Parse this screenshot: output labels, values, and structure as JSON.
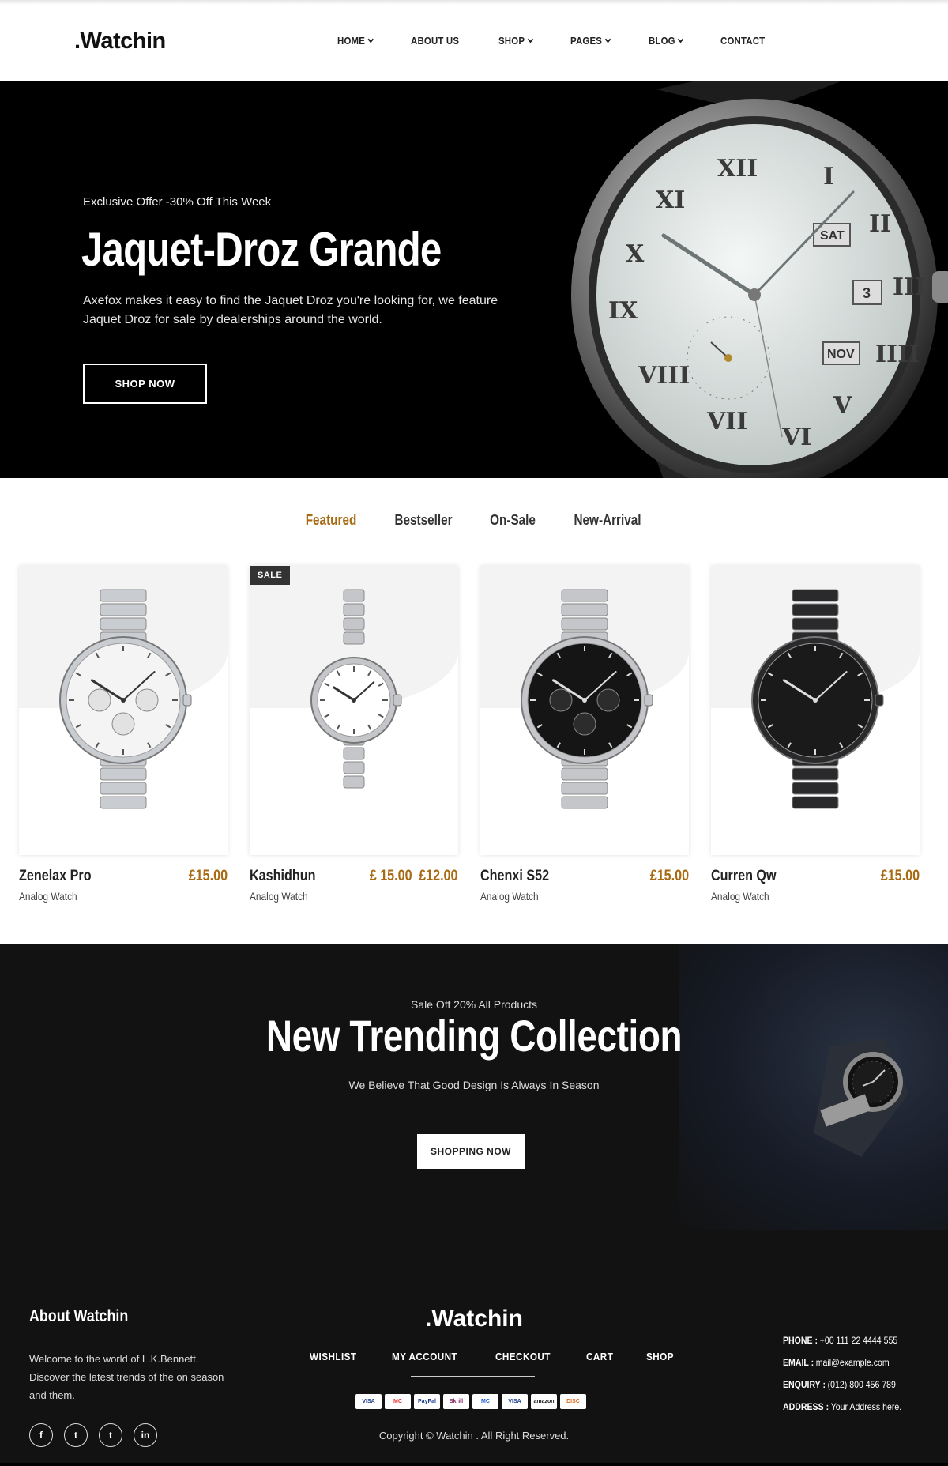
{
  "header": {
    "logo": ".Watchin",
    "nav": [
      {
        "label": "HOME",
        "dropdown": true
      },
      {
        "label": "ABOUT US",
        "dropdown": false
      },
      {
        "label": "SHOP",
        "dropdown": true
      },
      {
        "label": "PAGES",
        "dropdown": true
      },
      {
        "label": "BLOG",
        "dropdown": true
      },
      {
        "label": "CONTACT",
        "dropdown": false
      }
    ]
  },
  "hero": {
    "offer": "Exclusive Offer -30% Off This Week",
    "title": "Jaquet-Droz Grande",
    "description": "Axefox makes it easy to find the Jaquet Droz you're looking for, we feature Jaquet Droz for sale by dealerships around the world.",
    "button": "SHOP NOW",
    "watch_labels": {
      "day": "SAT",
      "date": "3",
      "month": "NOV"
    }
  },
  "tabs": [
    {
      "label": "Featured",
      "active": true
    },
    {
      "label": "Bestseller",
      "active": false
    },
    {
      "label": "On-Sale",
      "active": false
    },
    {
      "label": "New-Arrival",
      "active": false
    }
  ],
  "products": [
    {
      "name": "Zenelax Pro",
      "category": "Analog Watch",
      "price": "£15.00",
      "old_price": "",
      "sale": false,
      "dial": "#f4f4f4",
      "metal": "#c9ccd0"
    },
    {
      "name": "Kashidhun",
      "category": "Analog Watch",
      "price": "£12.00",
      "old_price": "£ 15.00",
      "sale": true,
      "sale_label": "SALE",
      "dial": "#ffffff",
      "metal": "#c4c6ca"
    },
    {
      "name": "Chenxi S52",
      "category": "Analog Watch",
      "price": "£15.00",
      "old_price": "",
      "sale": false,
      "dial": "#151515",
      "metal": "#c4c6ca"
    },
    {
      "name": "Curren Qw",
      "category": "Analog Watch",
      "price": "£15.00",
      "old_price": "",
      "sale": false,
      "dial": "#1a1a1a",
      "metal": "#2a2a2c"
    }
  ],
  "banner": {
    "subtitle": "Sale Off 20% All Products",
    "title": "New Trending Collection",
    "description": "We Believe That Good Design Is Always In Season",
    "button": "SHOPPING NOW"
  },
  "footer": {
    "about_title": "About Watchin",
    "about_text": "Welcome to the world of L.K.Bennett. Discover the latest trends of the on season and them.",
    "socials": [
      {
        "icon": "facebook-icon",
        "glyph": "f"
      },
      {
        "icon": "twitter-icon",
        "glyph": "t"
      },
      {
        "icon": "tumblr-icon",
        "glyph": "t"
      },
      {
        "icon": "linkedin-icon",
        "glyph": "in"
      }
    ],
    "logo": ".Watchin",
    "links": [
      "WISHLIST",
      "MY ACCOUNT",
      "CHECKOUT",
      "CART",
      "SHOP"
    ],
    "payments": [
      "VISA",
      "MC",
      "PayPal",
      "Skrill",
      "MC",
      "VISA",
      "amazon",
      "DISC"
    ],
    "copyright": "Copyright © Watchin . All Right Reserved.",
    "contact": [
      {
        "label": "PHONE :",
        "value": "+00 111 22 4444 555"
      },
      {
        "label": "EMAIL :",
        "value": "mail@example.com"
      },
      {
        "label": "ENQUIRY :",
        "value": "(012) 800 456 789"
      },
      {
        "label": "ADDRESS :",
        "value": "Your Address here."
      }
    ]
  },
  "colors": {
    "accent": "#a86a12",
    "dark": "#121212"
  }
}
